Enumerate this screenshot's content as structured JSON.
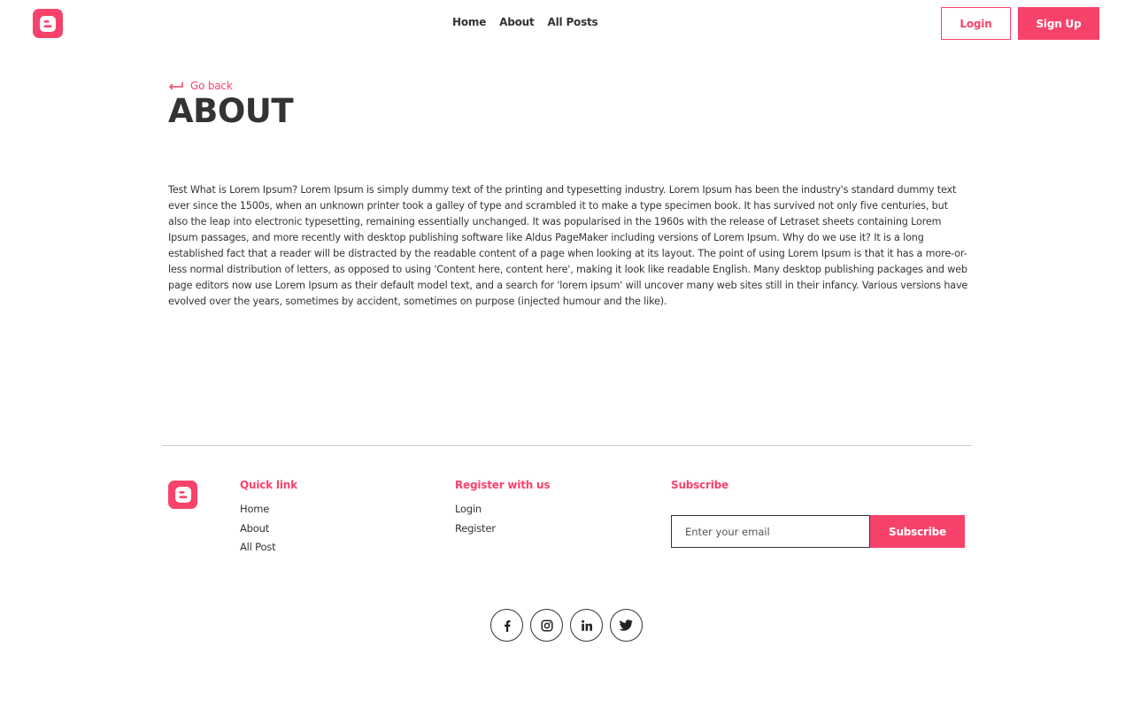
{
  "nav": {
    "logo_icon": "blogger-logo-icon",
    "links": [
      "Home",
      "About",
      "All Posts"
    ],
    "login_label": "Login",
    "signup_label": "Sign Up"
  },
  "page": {
    "back_icon": "return-arrow-icon",
    "back_label": "Go back",
    "title": "ABOUT",
    "body": "Test What is Lorem Ipsum? Lorem Ipsum is simply dummy text of the printing and typesetting industry. Lorem Ipsum has been the industry's standard dummy text ever since the 1500s, when an unknown printer took a galley of type and scrambled it to make a type specimen book. It has survived not only five centuries, but also the leap into electronic typesetting, remaining essentially unchanged. It was popularised in the 1960s with the release of Letraset sheets containing Lorem Ipsum passages, and more recently with desktop publishing software like Aldus PageMaker including versions of Lorem Ipsum. Why do we use it? It is a long established fact that a reader will be distracted by the readable content of a page when looking at its layout. The point of using Lorem Ipsum is that it has a more-or-less normal distribution of letters, as opposed to using 'Content here, content here', making it look like readable English. Many desktop publishing packages and web page editors now use Lorem Ipsum as their default model text, and a search for 'lorem ipsum' will uncover many web sites still in their infancy. Various versions have evolved over the years, sometimes by accident, sometimes on purpose (injected humour and the like)."
  },
  "footer": {
    "quick_link": {
      "heading": "Quick link",
      "links": [
        "Home",
        "About",
        "All Post"
      ]
    },
    "register": {
      "heading": "Register with us",
      "links": [
        "Login",
        "Register"
      ]
    },
    "subscribe": {
      "heading": "Subscribe",
      "placeholder": "Enter your email",
      "button_label": "Subscribe"
    },
    "social_icons": [
      "facebook-icon",
      "instagram-icon",
      "linkedin-icon",
      "twitter-icon"
    ]
  },
  "colors": {
    "accent": "#f7436b",
    "text": "#333333",
    "divider": "#cfcfcf"
  }
}
